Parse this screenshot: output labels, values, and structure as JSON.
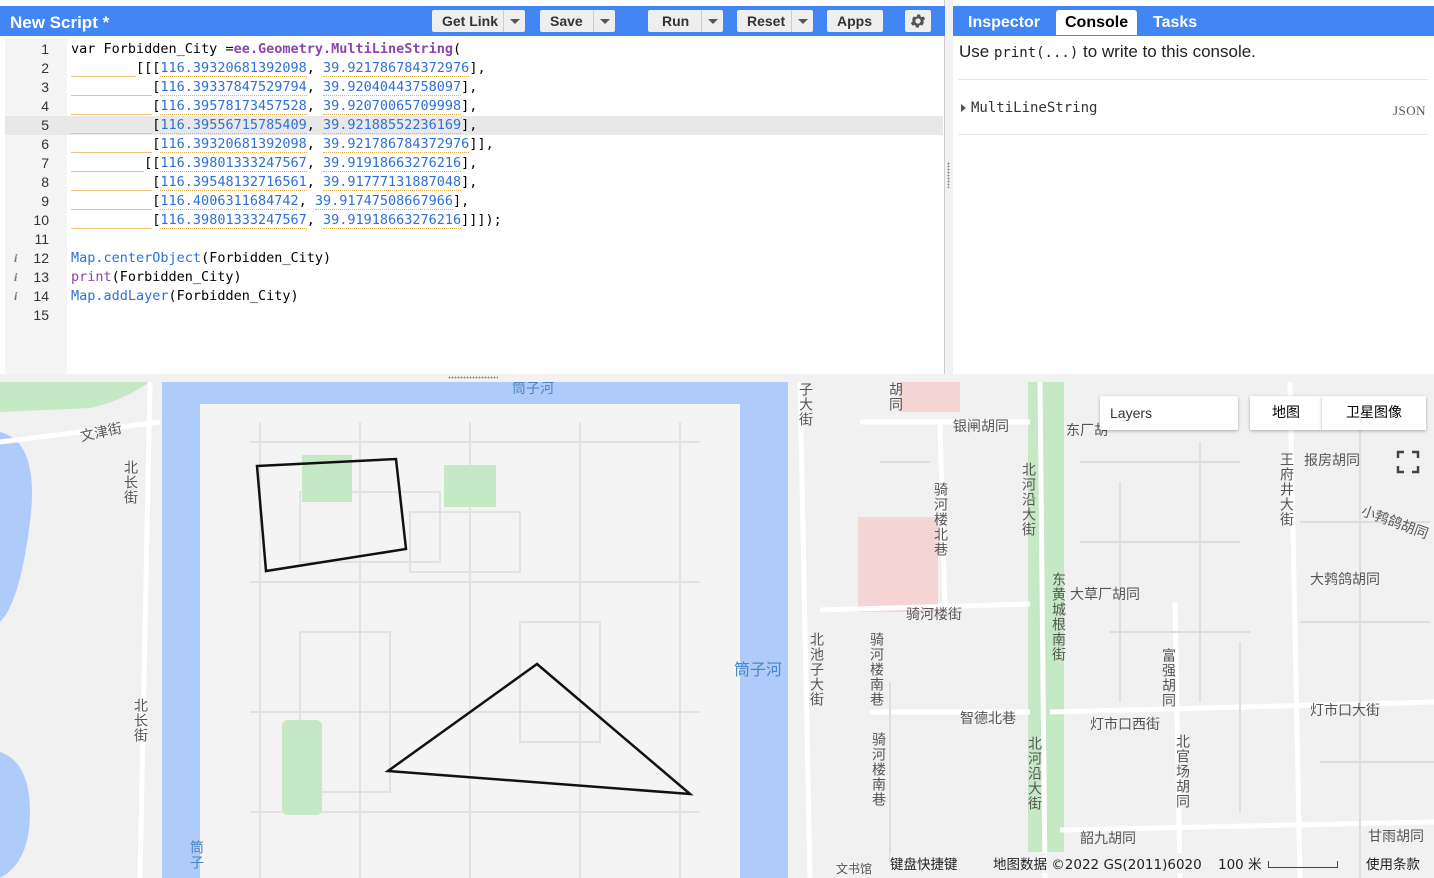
{
  "editor": {
    "title": "New Script *",
    "buttons": {
      "get_link": "Get Link",
      "save": "Save",
      "run": "Run",
      "reset": "Reset",
      "apps": "Apps"
    },
    "settings_icon": "gear-icon",
    "lines": [
      {
        "n": "1",
        "info": "",
        "text": ""
      },
      {
        "n": "2",
        "info": "",
        "text": ""
      },
      {
        "n": "3",
        "info": "",
        "text": ""
      },
      {
        "n": "4",
        "info": "",
        "text": ""
      },
      {
        "n": "5",
        "info": "",
        "text": ""
      },
      {
        "n": "6",
        "info": "",
        "text": ""
      },
      {
        "n": "7",
        "info": "",
        "text": ""
      },
      {
        "n": "8",
        "info": "",
        "text": ""
      },
      {
        "n": "9",
        "info": "",
        "text": ""
      },
      {
        "n": "10",
        "info": "",
        "text": ""
      },
      {
        "n": "11",
        "info": "",
        "text": ""
      },
      {
        "n": "12",
        "info": "i",
        "text": ""
      },
      {
        "n": "13",
        "info": "i",
        "text": ""
      },
      {
        "n": "14",
        "info": "i",
        "text": ""
      },
      {
        "n": "15",
        "info": "",
        "text": ""
      }
    ],
    "code": {
      "l1_var": "var",
      "l1_name": " Forbidden_City ",
      "l1_eq": "=",
      "l1_ctor": "ee.Geometry.MultiLineString",
      "l1_open": "(",
      "coords": [
        [
          "116.39320681392098",
          "39.921786784372976"
        ],
        [
          "116.39337847529794",
          "39.92040443758097"
        ],
        [
          "116.39578173457528",
          "39.92070065709998"
        ],
        [
          "116.39556715785409",
          "39.92188552236169"
        ],
        [
          "116.39320681392098",
          "39.921786784372976"
        ],
        [
          "116.39801333247567",
          "39.91918663276216"
        ],
        [
          "116.39548132716561",
          "39.91777131887048"
        ],
        [
          "116.4006311684742",
          "39.91747508667966"
        ],
        [
          "116.39801333247567",
          "39.91918663276216"
        ]
      ],
      "l12_obj": "Map",
      "l12_method": ".centerObject",
      "l12_arg": "(Forbidden_City)",
      "l13_fn": "print",
      "l13_arg": "(Forbidden_City)",
      "l14_obj": "Map",
      "l14_method": ".addLayer",
      "l14_arg": "(Forbidden_City)"
    }
  },
  "right_panel": {
    "tabs": [
      "Inspector",
      "Console",
      "Tasks"
    ],
    "active_tab": "Console",
    "console_hint_pre": "Use ",
    "console_hint_code": "print(...)",
    "console_hint_post": " to write to this console.",
    "output_item": "MultiLineString",
    "output_json": "JSON"
  },
  "map": {
    "layers_label": "Layers",
    "map_types": [
      "地图",
      "卫星图像"
    ],
    "fullscreen_icon": "fullscreen-icon",
    "labels": {
      "wenjinjie": "文津街",
      "beichangjie_top": "北长街",
      "beichangjie_bottom": "北长街",
      "tongzihe_top": "筒子河",
      "tongzihe_right": "筒子河",
      "tongzihe_bottom": "筒子",
      "nanchizi_top": "子大街",
      "hutong_top": "胡同",
      "yinzha": "银闸胡同",
      "qiheloubei": "骑河楼北巷",
      "qihelou": "骑河楼街",
      "qihelounan1": "骑河楼南巷",
      "qihelounan2": "骑河楼南巷",
      "beichizi": "北池子大街",
      "beiheyan1": "北河沿大街",
      "beiheyan2": "北河沿大街",
      "donghuangcheng": "东黄城根南街",
      "dongchang": "东厂胡",
      "dacaochang": "大草厂胡同",
      "zhidebei": "智德北巷",
      "dengshikouxi": "灯市口西街",
      "dengshikou": "灯市口大街",
      "wangfujing": "王府井大街",
      "baofang": "报房胡同",
      "xiaojuer": "小鹁鸽胡同",
      "dajuer": "大鹁鸽胡同",
      "fuqiang": "富强胡同",
      "beiguanchang": "北官场胡同",
      "shaojiu": "韶九胡同",
      "ganyu": "甘雨胡同",
      "wenshuguan": "文书馆"
    },
    "footer": {
      "shortcuts": "键盘快捷键",
      "attribution": "地图数据 ©2022 GS(2011)6020",
      "scale": "100 米",
      "terms": "使用条款"
    },
    "geometry_color": "#111111",
    "water_color": "#aecbfa",
    "park_color": "#c5e8c5"
  }
}
